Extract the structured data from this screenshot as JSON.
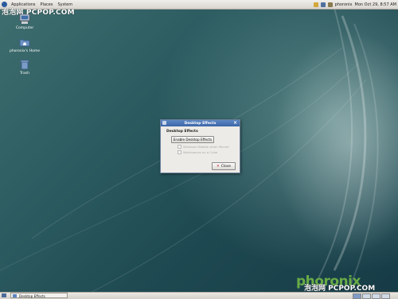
{
  "top_panel": {
    "menus": [
      "Applications",
      "Places",
      "System"
    ],
    "user": "phoronix",
    "clock": "Mon Oct 29,  8:57 AM"
  },
  "watermark": {
    "top": "泡泡网 PCPOP.COM",
    "bottom": "泡泡网 PCPOP.COM",
    "phoronix_logo": "phoronix"
  },
  "desktop_icons": [
    {
      "label": "Computer",
      "icon": "computer-icon"
    },
    {
      "label": "phoronix's Home",
      "icon": "home-folder-icon"
    },
    {
      "label": "Trash",
      "icon": "trash-icon"
    }
  ],
  "dialog": {
    "title": "Desktop Effects",
    "heading": "Desktop Effects",
    "enable_button": "Enable Desktop Effects",
    "options": [
      "Windows Wobble when Moved",
      "Workspaces on a Cube"
    ],
    "close_button": "Close"
  },
  "bottom_panel": {
    "task_label": "Desktop Effects",
    "workspaces": 4
  },
  "colors": {
    "desktop_bg": "#1f4a52",
    "titlebar": "#3c66a8",
    "panel": "#e4e1dc"
  }
}
